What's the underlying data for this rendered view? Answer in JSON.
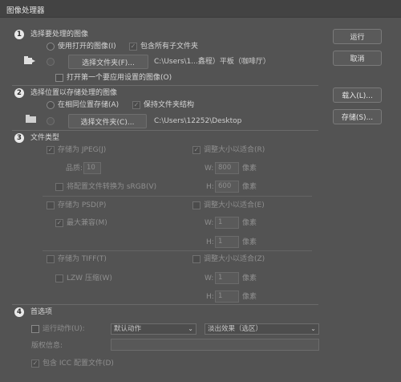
{
  "window": {
    "title": "图像处理器"
  },
  "s1": {
    "badge": "1",
    "title": "选择要处理的图像",
    "use_open": "使用打开的图像(I)",
    "include_sub": "包含所有子文件夹",
    "select_folder": "选择文件夹(F)...",
    "path": "C:\\Users\\1...鑫程）平板（咖啡厅）",
    "open_first": "打开第一个要应用设置的图像(O)"
  },
  "s2": {
    "badge": "2",
    "title": "选择位置以存储处理的图像",
    "same_loc": "在相同位置存储(A)",
    "keep_struct": "保持文件夹结构",
    "select_folder": "选择文件夹(C)...",
    "path": "C:\\Users\\12252\\Desktop"
  },
  "s3": {
    "badge": "3",
    "title": "文件类型",
    "jpeg": {
      "save": "存储为 JPEG(J)",
      "resize": "调整大小以适合(R)",
      "quality_label": "品质:",
      "quality": "10",
      "w_label": "W:",
      "w": "800",
      "px1": "像素",
      "convert": "将配置文件转换为 sRGB(V)",
      "h_label": "H:",
      "h": "600",
      "px2": "像素"
    },
    "psd": {
      "save": "存储为 PSD(P)",
      "resize": "调整大小以适合(E)",
      "compat": "最大兼容(M)",
      "w_label": "W:",
      "w": "1",
      "px1": "像素",
      "h_label": "H:",
      "h": "1",
      "px2": "像素"
    },
    "tiff": {
      "save": "存储为 TIFF(T)",
      "resize": "调整大小以适合(Z)",
      "lzw": "LZW 压缩(W)",
      "w_label": "W:",
      "w": "1",
      "px1": "像素",
      "h_label": "H:",
      "h": "1",
      "px2": "像素"
    }
  },
  "s4": {
    "badge": "4",
    "title": "首选项",
    "run_action": "运行动作(U):",
    "action_set": "默认动作",
    "action": "淡出效果（选区）",
    "copyright": "版权信息:",
    "include_icc": "包含 ICC 配置文件(D)"
  },
  "buttons": {
    "run": "运行",
    "cancel": "取消",
    "load": "载入(L)...",
    "save": "存储(S)..."
  }
}
